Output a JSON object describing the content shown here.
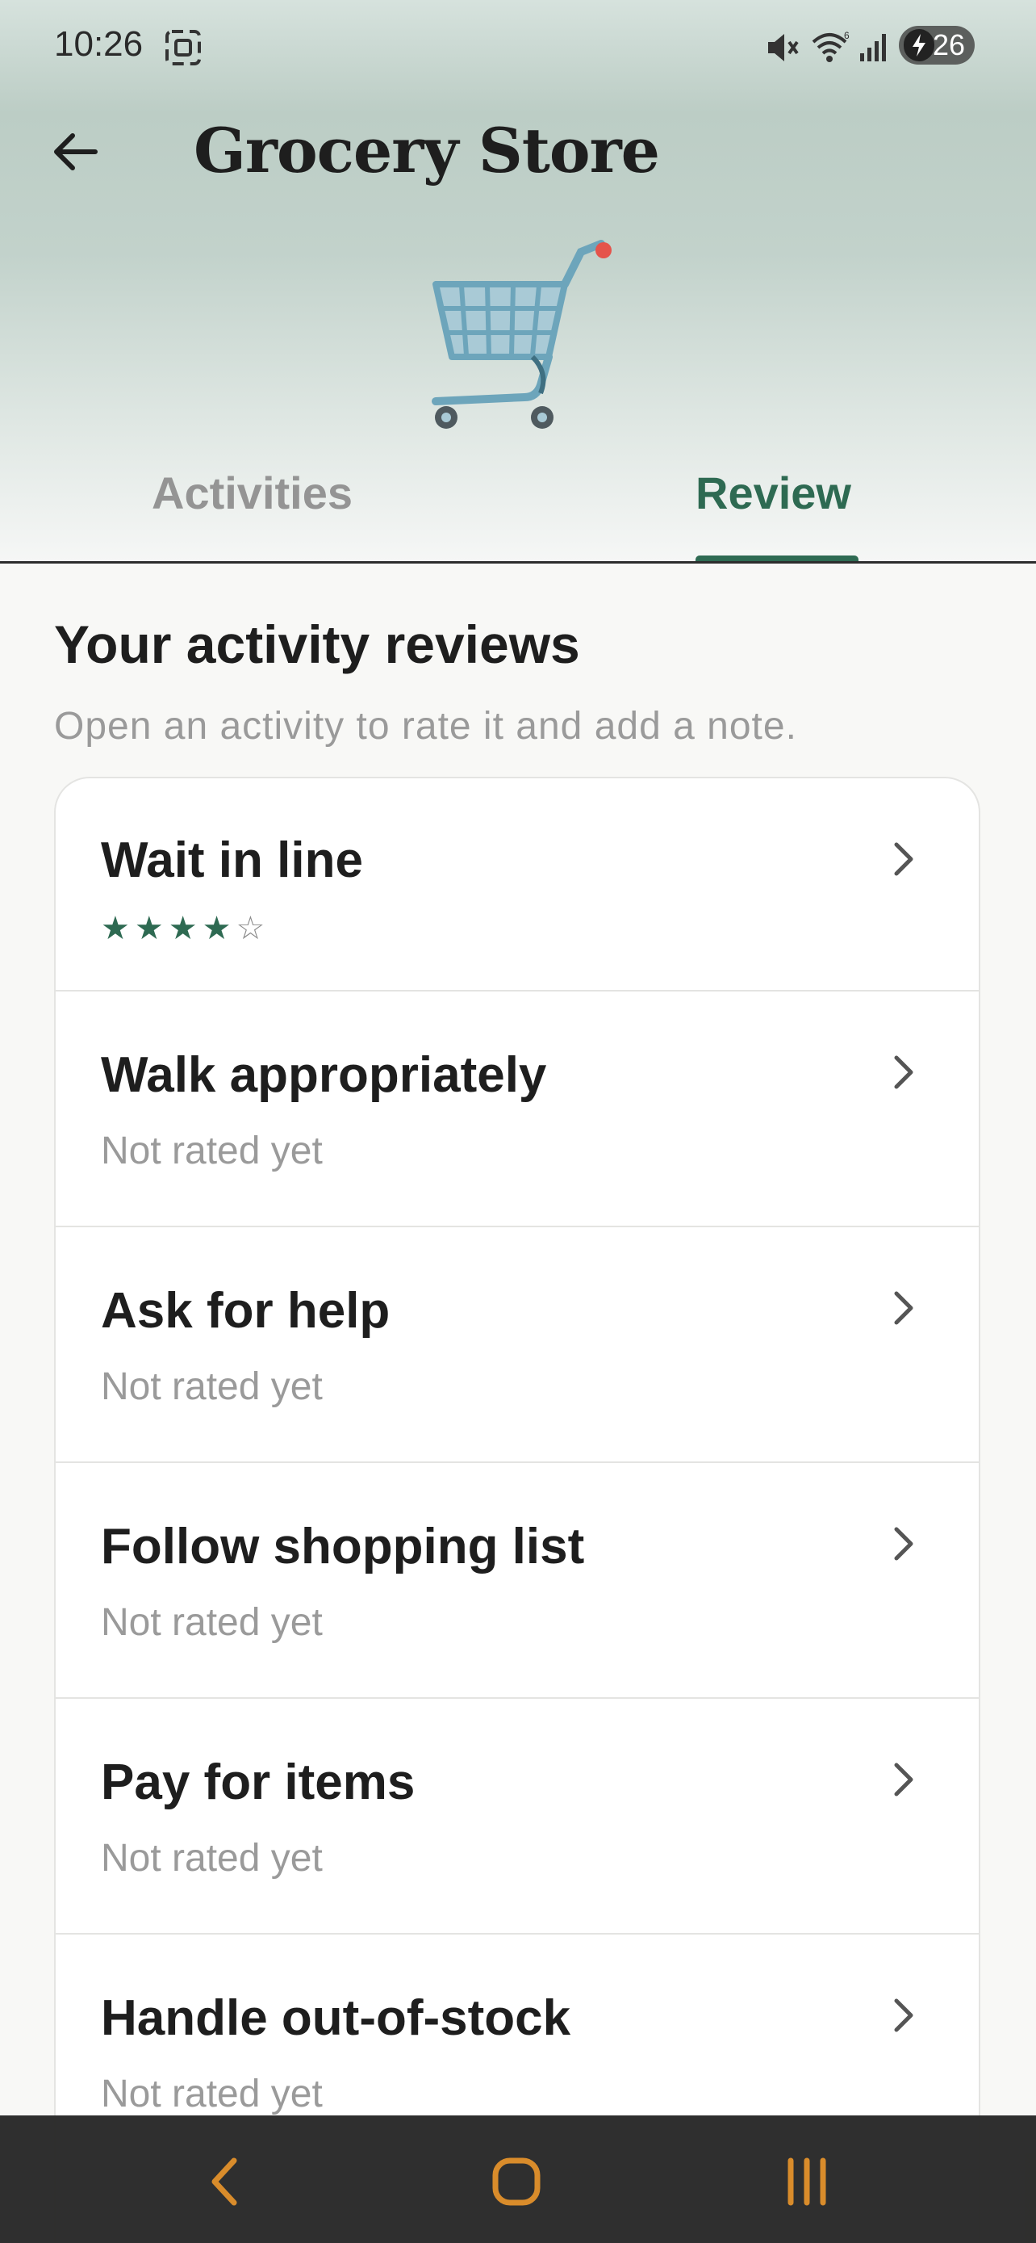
{
  "status_bar": {
    "time": "10:26",
    "battery_level": "26",
    "icons": [
      "screenshot-icon",
      "mute-icon",
      "wifi-icon",
      "signal-icon",
      "battery-charging-icon"
    ]
  },
  "header": {
    "title": "Grocery Store",
    "illustration": "shopping-cart-icon"
  },
  "tabs": [
    {
      "label": "Activities",
      "selected": false
    },
    {
      "label": "Review",
      "selected": true
    }
  ],
  "colors": {
    "accent": "#2e6a52",
    "muted_text": "#9a9a9a",
    "nav_icon": "#d98c2b"
  },
  "reviews": {
    "title": "Your activity reviews",
    "subtitle": "Open an activity to rate it and add a note.",
    "items": [
      {
        "title": "Wait in line",
        "rating": 4,
        "rating_max": 5,
        "status": ""
      },
      {
        "title": "Walk appropriately",
        "status": "Not rated yet"
      },
      {
        "title": "Ask for help",
        "status": "Not rated yet"
      },
      {
        "title": "Follow shopping list",
        "status": "Not rated yet"
      },
      {
        "title": "Pay for items",
        "status": "Not rated yet"
      },
      {
        "title": "Handle out-of-stock",
        "status": "Not rated yet"
      }
    ]
  },
  "system_nav": {
    "items": [
      "back-icon",
      "home-icon",
      "recents-icon"
    ]
  }
}
